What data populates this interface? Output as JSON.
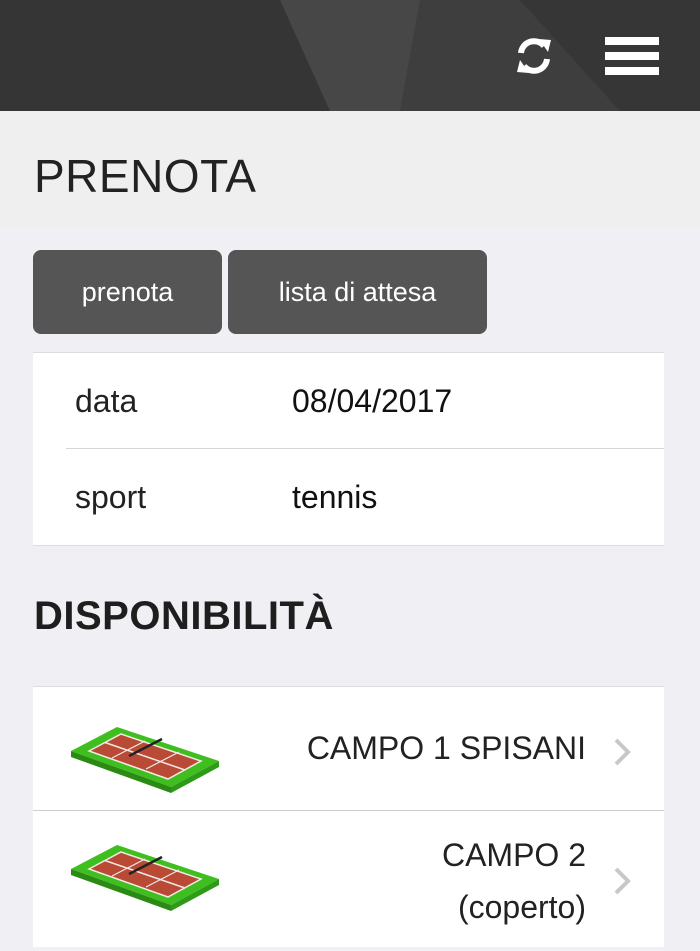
{
  "header": {
    "refresh_icon": "refresh-icon",
    "menu_icon": "hamburger-menu-icon"
  },
  "page": {
    "title": "PRENOTA"
  },
  "tabs": [
    {
      "label": "prenota"
    },
    {
      "label": "lista di attesa"
    }
  ],
  "form": {
    "rows": [
      {
        "label": "data",
        "value": "08/04/2017"
      },
      {
        "label": "sport",
        "value": "tennis"
      }
    ]
  },
  "availability": {
    "title": "DISPONIBILITÀ",
    "items": [
      {
        "name": "CAMPO 1 SPISANI",
        "icon": "tennis-court-icon"
      },
      {
        "name_line1": "CAMPO 2",
        "name_line2": "(coperto)",
        "icon": "tennis-court-icon"
      }
    ]
  },
  "colors": {
    "header_bg": "#3b3b3b",
    "tab_bg": "#555555",
    "page_bg": "#efeff4",
    "court_green": "#3fbf1f",
    "court_clay": "#b84a36"
  }
}
